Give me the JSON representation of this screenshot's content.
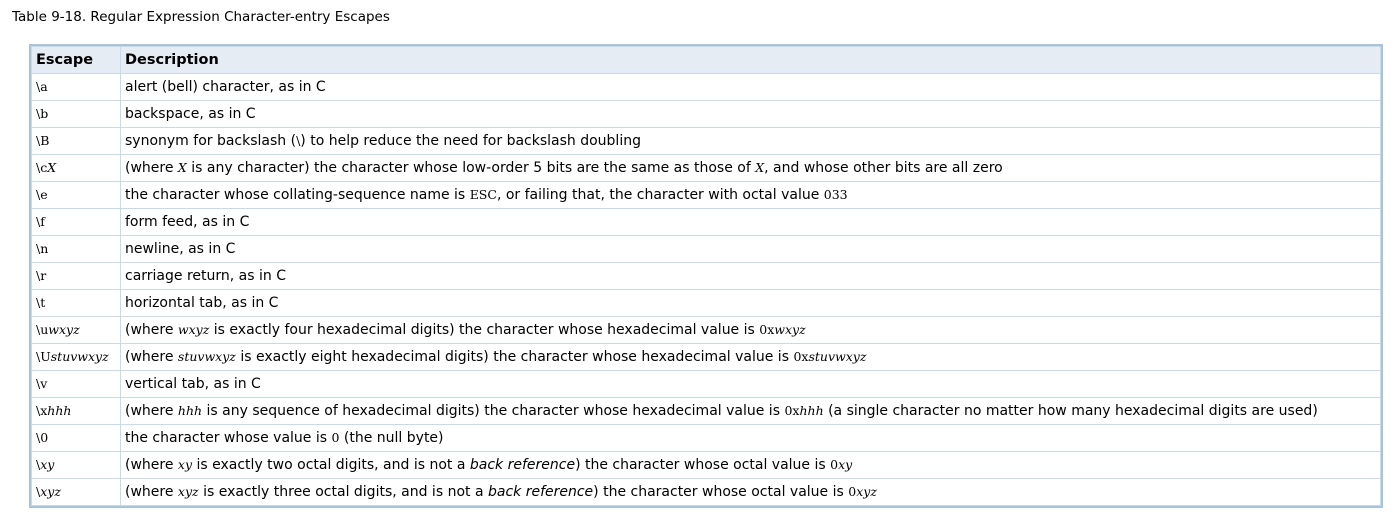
{
  "caption": "Table 9-18. Regular Expression Character-entry Escapes",
  "headers": {
    "escape": "Escape",
    "description": "Description"
  },
  "rows": [
    {
      "esc": [
        {
          "t": "\\a",
          "k": "m"
        }
      ],
      "desc": [
        {
          "t": "alert (bell) character, as in C"
        }
      ]
    },
    {
      "esc": [
        {
          "t": "\\b",
          "k": "m"
        }
      ],
      "desc": [
        {
          "t": "backspace, as in C"
        }
      ]
    },
    {
      "esc": [
        {
          "t": "\\B",
          "k": "m"
        }
      ],
      "desc": [
        {
          "t": "synonym for backslash ("
        },
        {
          "t": "\\",
          "k": "m"
        },
        {
          "t": ") to help reduce the need for backslash doubling"
        }
      ]
    },
    {
      "esc": [
        {
          "t": "\\c",
          "k": "m"
        },
        {
          "t": "X",
          "k": "v"
        }
      ],
      "desc": [
        {
          "t": "(where "
        },
        {
          "t": "X",
          "k": "v"
        },
        {
          "t": " is any character) the character whose low-order 5 bits are the same as those of "
        },
        {
          "t": "X",
          "k": "v"
        },
        {
          "t": ", and whose other bits are all zero"
        }
      ]
    },
    {
      "esc": [
        {
          "t": "\\e",
          "k": "m"
        }
      ],
      "desc": [
        {
          "t": "the character whose collating-sequence name is "
        },
        {
          "t": "ESC",
          "k": "m"
        },
        {
          "t": ", or failing that, the character with octal value "
        },
        {
          "t": "033",
          "k": "m"
        }
      ]
    },
    {
      "esc": [
        {
          "t": "\\f",
          "k": "m"
        }
      ],
      "desc": [
        {
          "t": "form feed, as in C"
        }
      ]
    },
    {
      "esc": [
        {
          "t": "\\n",
          "k": "m"
        }
      ],
      "desc": [
        {
          "t": "newline, as in C"
        }
      ]
    },
    {
      "esc": [
        {
          "t": "\\r",
          "k": "m"
        }
      ],
      "desc": [
        {
          "t": "carriage return, as in C"
        }
      ]
    },
    {
      "esc": [
        {
          "t": "\\t",
          "k": "m"
        }
      ],
      "desc": [
        {
          "t": "horizontal tab, as in C"
        }
      ]
    },
    {
      "esc": [
        {
          "t": "\\u",
          "k": "m"
        },
        {
          "t": "wxyz",
          "k": "v"
        }
      ],
      "desc": [
        {
          "t": "(where "
        },
        {
          "t": "wxyz",
          "k": "v"
        },
        {
          "t": " is exactly four hexadecimal digits) the character whose hexadecimal value is "
        },
        {
          "t": "0x",
          "k": "m"
        },
        {
          "t": "wxyz",
          "k": "v"
        }
      ]
    },
    {
      "esc": [
        {
          "t": "\\U",
          "k": "m"
        },
        {
          "t": "stuvwxyz",
          "k": "v"
        }
      ],
      "desc": [
        {
          "t": "(where "
        },
        {
          "t": "stuvwxyz",
          "k": "v"
        },
        {
          "t": " is exactly eight hexadecimal digits) the character whose hexadecimal value is "
        },
        {
          "t": "0x",
          "k": "m"
        },
        {
          "t": "stuvwxyz",
          "k": "v"
        }
      ]
    },
    {
      "esc": [
        {
          "t": "\\v",
          "k": "m"
        }
      ],
      "desc": [
        {
          "t": "vertical tab, as in C"
        }
      ]
    },
    {
      "esc": [
        {
          "t": "\\x",
          "k": "m"
        },
        {
          "t": "hhh",
          "k": "v"
        }
      ],
      "desc": [
        {
          "t": "(where "
        },
        {
          "t": "hhh",
          "k": "v"
        },
        {
          "t": " is any sequence of hexadecimal digits) the character whose hexadecimal value is "
        },
        {
          "t": "0x",
          "k": "m"
        },
        {
          "t": "hhh",
          "k": "v"
        },
        {
          "t": " (a single character no matter how many hexadecimal digits are used)"
        }
      ]
    },
    {
      "esc": [
        {
          "t": "\\0",
          "k": "m"
        }
      ],
      "desc": [
        {
          "t": "the character whose value is "
        },
        {
          "t": "0",
          "k": "m"
        },
        {
          "t": " (the null byte)"
        }
      ]
    },
    {
      "esc": [
        {
          "t": "\\",
          "k": "m"
        },
        {
          "t": "xy",
          "k": "v"
        }
      ],
      "desc": [
        {
          "t": "(where "
        },
        {
          "t": "xy",
          "k": "v"
        },
        {
          "t": " is exactly two octal digits, and is not a "
        },
        {
          "t": "back reference",
          "k": "e"
        },
        {
          "t": ") the character whose octal value is "
        },
        {
          "t": "0",
          "k": "m"
        },
        {
          "t": "xy",
          "k": "v"
        }
      ]
    },
    {
      "esc": [
        {
          "t": "\\",
          "k": "m"
        },
        {
          "t": "xyz",
          "k": "v"
        }
      ],
      "desc": [
        {
          "t": "(where "
        },
        {
          "t": "xyz",
          "k": "v"
        },
        {
          "t": " is exactly three octal digits, and is not a "
        },
        {
          "t": "back reference",
          "k": "e"
        },
        {
          "t": ") the character whose octal value is "
        },
        {
          "t": "0",
          "k": "m"
        },
        {
          "t": "xyz",
          "k": "v"
        }
      ]
    }
  ]
}
